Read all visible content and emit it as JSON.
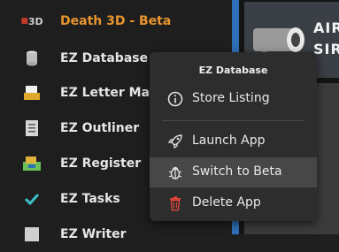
{
  "apps": [
    {
      "label": "Death 3D - Beta",
      "icon": "death-3d-logo-icon",
      "icon_text": "3D",
      "active": true
    },
    {
      "label": "EZ Database",
      "icon": "database-icon"
    },
    {
      "label": "EZ Letter Maker",
      "icon": "letter-icon"
    },
    {
      "label": "EZ Outliner",
      "icon": "outliner-icon"
    },
    {
      "label": "EZ Register",
      "icon": "register-icon"
    },
    {
      "label": "EZ Tasks",
      "icon": "checkmark-icon"
    },
    {
      "label": "EZ Writer",
      "icon": "writer-icon"
    }
  ],
  "banner": {
    "line1": "AIR",
    "line2": "SIR"
  },
  "context_menu": {
    "title": "EZ Database",
    "items": [
      {
        "label": "Store Listing",
        "icon": "info-icon"
      },
      {
        "label": "Launch App",
        "icon": "rocket-icon"
      },
      {
        "label": "Switch to Beta",
        "icon": "bug-icon",
        "hovered": true
      },
      {
        "label": "Delete App",
        "icon": "trash-icon",
        "icon_color": "#e0453a"
      }
    ]
  },
  "colors": {
    "active_label": "#e8952e",
    "accent_strip": "#2f6fb7",
    "delete_red": "#e0453a"
  }
}
